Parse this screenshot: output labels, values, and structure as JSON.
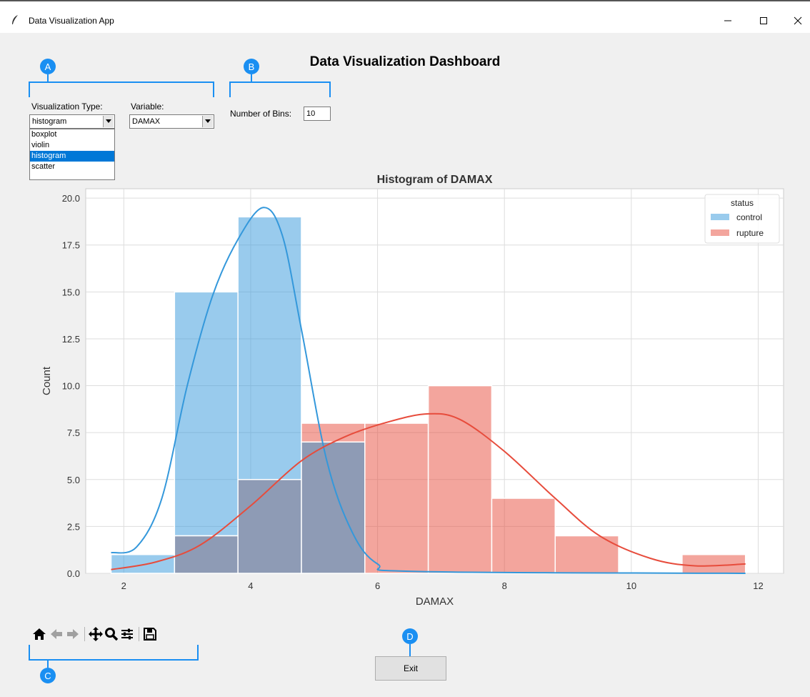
{
  "window": {
    "title": "Data Visualization App"
  },
  "dashboard": {
    "title": "Data Visualization Dashboard"
  },
  "callouts": {
    "a": "A",
    "b": "B",
    "c": "C",
    "d": "D"
  },
  "controls": {
    "viz_type_label": "Visualization Type:",
    "viz_type_value": "histogram",
    "viz_type_options": [
      "boxplot",
      "violin",
      "histogram",
      "scatter"
    ],
    "variable_label": "Variable:",
    "variable_value": "DAMAX",
    "bins_label": "Number of Bins:",
    "bins_value": "10"
  },
  "toolbar": {
    "icons": [
      "home-icon",
      "back-icon",
      "forward-icon",
      "pan-icon",
      "zoom-icon",
      "configure-icon",
      "save-icon"
    ]
  },
  "exit_label": "Exit",
  "colors": {
    "accent": "#1a8ff2",
    "control": "#3498db",
    "rupture": "#e74c3c",
    "overlap": "#8e9bb5"
  },
  "chart_data": {
    "type": "bar",
    "title": "Histogram of DAMAX",
    "xlabel": "DAMAX",
    "ylabel": "Count",
    "xlim": [
      1.4,
      12.4
    ],
    "ylim": [
      0,
      20.5
    ],
    "xticks": [
      2,
      4,
      6,
      8,
      10,
      12
    ],
    "yticks": [
      0.0,
      2.5,
      5.0,
      7.5,
      10.0,
      12.5,
      15.0,
      17.5,
      20.0
    ],
    "bin_edges": [
      1.8,
      2.8,
      3.8,
      4.8,
      5.8,
      6.8,
      7.8,
      8.8,
      9.8,
      10.8,
      11.8
    ],
    "legend": {
      "title": "status",
      "placement": "top-right"
    },
    "grid": true,
    "series": [
      {
        "name": "control",
        "values": [
          1,
          15,
          19,
          7,
          0,
          0,
          0,
          0,
          0,
          0
        ],
        "kde": [
          [
            1.8,
            1.1
          ],
          [
            2.2,
            1.4
          ],
          [
            2.6,
            4.0
          ],
          [
            3.0,
            10.0
          ],
          [
            3.4,
            14.8
          ],
          [
            3.8,
            17.8
          ],
          [
            4.2,
            19.5
          ],
          [
            4.5,
            18.0
          ],
          [
            4.8,
            13.0
          ],
          [
            5.2,
            6.0
          ],
          [
            5.6,
            2.2
          ],
          [
            6.0,
            0.5
          ],
          [
            6.6,
            0.1
          ],
          [
            11.8,
            0.0
          ]
        ]
      },
      {
        "name": "rupture",
        "values": [
          0,
          2,
          5,
          8,
          8,
          10,
          4,
          2,
          0,
          1
        ],
        "kde": [
          [
            1.8,
            0.2
          ],
          [
            2.5,
            0.6
          ],
          [
            3.2,
            1.5
          ],
          [
            4.0,
            3.6
          ],
          [
            4.8,
            6.0
          ],
          [
            5.5,
            7.3
          ],
          [
            6.2,
            8.1
          ],
          [
            6.8,
            8.5
          ],
          [
            7.3,
            8.2
          ],
          [
            8.0,
            6.5
          ],
          [
            8.8,
            4.0
          ],
          [
            9.5,
            2.0
          ],
          [
            10.3,
            0.8
          ],
          [
            11.0,
            0.4
          ],
          [
            11.8,
            0.5
          ]
        ]
      }
    ]
  }
}
